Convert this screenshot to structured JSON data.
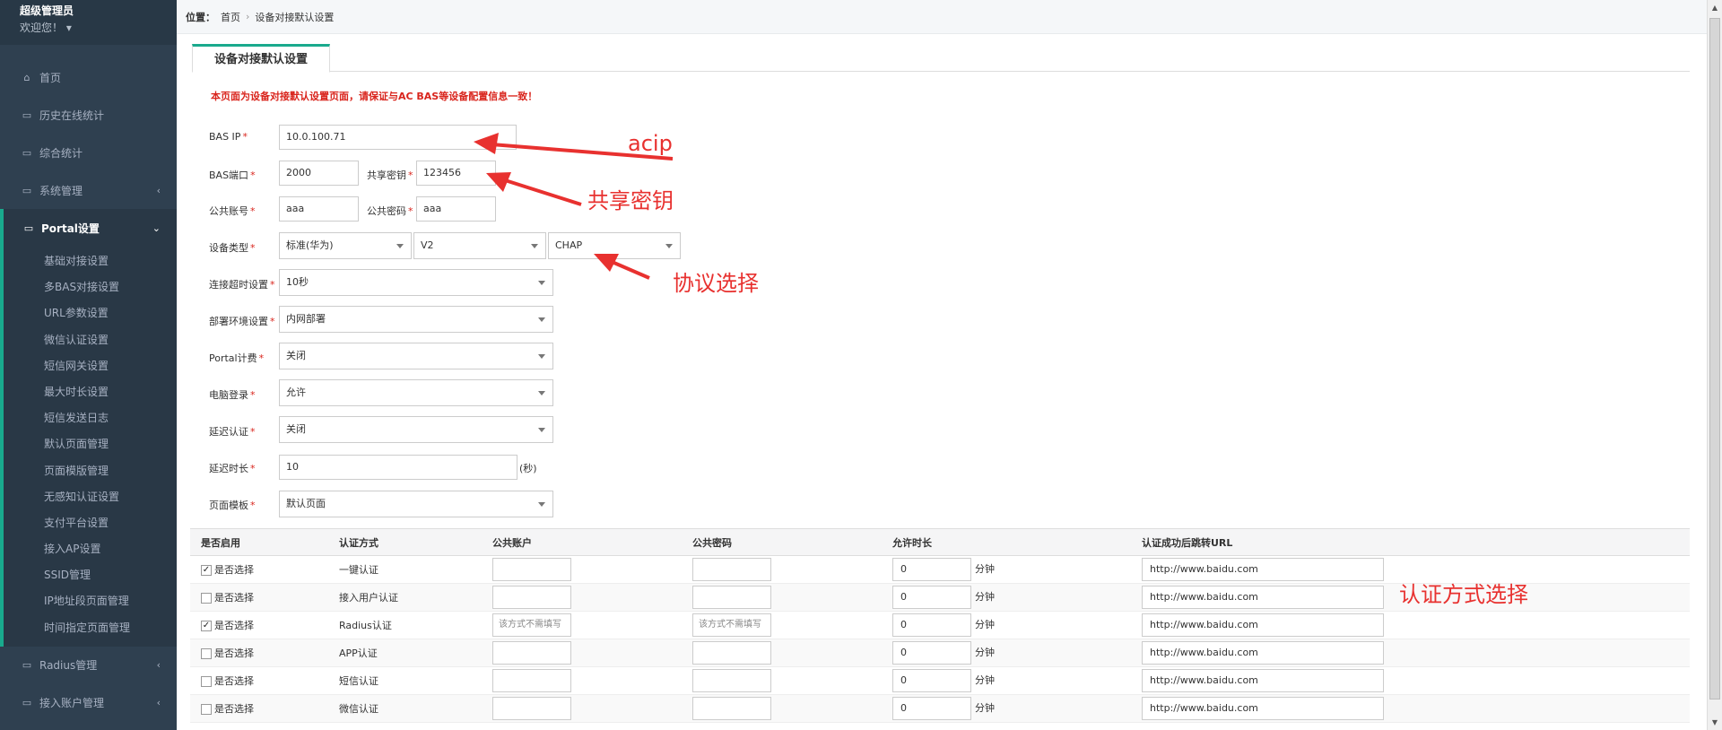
{
  "sidebar": {
    "user_name": "超级管理员",
    "welcome": "欢迎您！",
    "items": [
      {
        "label": "首页",
        "icon": "home-icon"
      },
      {
        "label": "历史在线统计",
        "icon": "monitor-icon"
      },
      {
        "label": "综合统计",
        "icon": "monitor-icon"
      },
      {
        "label": "系统管理",
        "icon": "monitor-icon"
      },
      {
        "label": "Portal设置",
        "icon": "monitor-icon"
      }
    ],
    "portal_sub": [
      "基础对接设置",
      "多BAS对接设置",
      "URL参数设置",
      "微信认证设置",
      "短信网关设置",
      "最大时长设置",
      "短信发送日志",
      "默认页面管理",
      "页面模版管理",
      "无感知认证设置",
      "支付平台设置",
      "接入AP设置",
      "SSID管理",
      "IP地址段页面管理",
      "时间指定页面管理"
    ],
    "bottom_items": [
      {
        "label": "Radius管理"
      },
      {
        "label": "接入账户管理"
      }
    ]
  },
  "breadcrumb": {
    "label": "位置：",
    "home": "首页",
    "sep": "›",
    "current": "设备对接默认设置"
  },
  "tab": {
    "title": "设备对接默认设置"
  },
  "notice": "本页面为设备对接默认设置页面，请保证与AC BAS等设备配置信息一致！",
  "form": {
    "bas_ip_label": "BAS IP",
    "bas_ip": "10.0.100.71",
    "bas_port_label": "BAS端口",
    "bas_port": "2000",
    "secret_label": "共享密钥",
    "secret": "123456",
    "pub_account_label": "公共账号",
    "pub_account": "aaa",
    "pub_password_label": "公共密码",
    "pub_password": "aaa",
    "device_type_label": "设备类型",
    "device_type": "标准(华为)",
    "version": "V2",
    "protocol": "CHAP",
    "timeout_label": "连接超时设置",
    "timeout": "10秒",
    "deploy_label": "部署环境设置",
    "deploy": "内网部署",
    "billing_label": "Portal计费",
    "billing": "关闭",
    "pc_login_label": "电脑登录",
    "pc_login": "允许",
    "delay_auth_label": "延迟认证",
    "delay_auth": "关闭",
    "delay_time_label": "延迟时长",
    "delay_time": "10",
    "delay_unit": "(秒)",
    "template_label": "页面模板",
    "template": "默认页面",
    "required_mark": "*"
  },
  "table": {
    "headers": [
      "是否启用",
      "认证方式",
      "公共账户",
      "公共密码",
      "允许时长",
      "认证成功后跳转URL"
    ],
    "checkbox_label": "是否选择",
    "unit": "分钟",
    "placeholder": "该方式不需填写",
    "rows": [
      {
        "checked": true,
        "method": "一键认证",
        "account": "",
        "password": "",
        "time": "0",
        "url": "http://www.baidu.com"
      },
      {
        "checked": false,
        "method": "接入用户认证",
        "account": "",
        "password": "",
        "time": "0",
        "url": "http://www.baidu.com"
      },
      {
        "checked": true,
        "method": "Radius认证",
        "account": "该方式不需填写",
        "password": "该方式不需填写",
        "time": "0",
        "url": "http://www.baidu.com"
      },
      {
        "checked": false,
        "method": "APP认证",
        "account": "",
        "password": "",
        "time": "0",
        "url": "http://www.baidu.com"
      },
      {
        "checked": false,
        "method": "短信认证",
        "account": "",
        "password": "",
        "time": "0",
        "url": "http://www.baidu.com"
      },
      {
        "checked": false,
        "method": "微信认证",
        "account": "",
        "password": "",
        "time": "0",
        "url": "http://www.baidu.com"
      }
    ]
  },
  "annotations": {
    "acip": "acip",
    "secret": "共享密钥",
    "protocol": "协议选择",
    "auth": "认证方式选择",
    "color": "#e8312f"
  }
}
